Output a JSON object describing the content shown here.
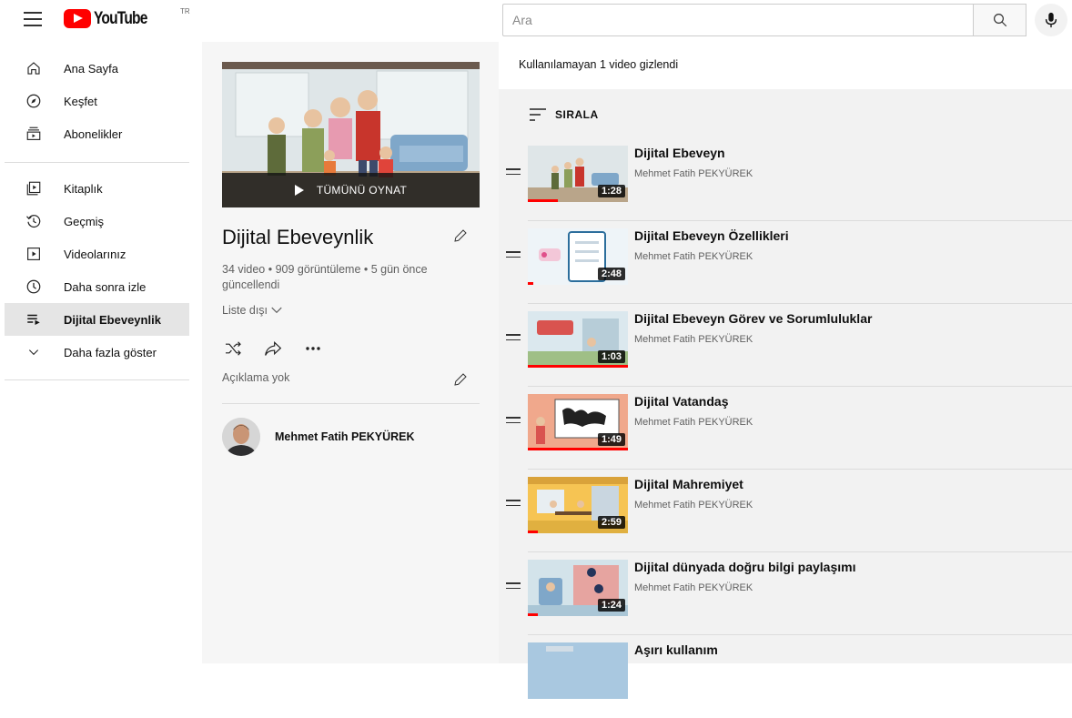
{
  "header": {
    "logo_text": "YouTube",
    "logo_country": "TR",
    "search_placeholder": "Ara",
    "icons": [
      "menu-icon",
      "search-icon",
      "mic-icon"
    ]
  },
  "sidebar": {
    "items": [
      {
        "label": "Ana Sayfa",
        "icon": "home-icon"
      },
      {
        "label": "Keşfet",
        "icon": "compass-icon"
      },
      {
        "label": "Abonelikler",
        "icon": "subscriptions-icon"
      },
      {
        "label": "Kitaplık",
        "icon": "library-icon"
      },
      {
        "label": "Geçmiş",
        "icon": "history-icon"
      },
      {
        "label": "Videolarınız",
        "icon": "your-videos-icon"
      },
      {
        "label": "Daha sonra izle",
        "icon": "watch-later-icon"
      },
      {
        "label": "Dijital Ebeveynlik",
        "icon": "playlist-icon",
        "active": true
      },
      {
        "label": "Daha fazla göster",
        "icon": "chevron-down-icon"
      }
    ]
  },
  "playlist": {
    "play_all": "TÜMÜNÜ OYNAT",
    "title": "Dijital Ebeveynlik",
    "stats": "34 video • 909 görüntüleme • 5 gün önce güncellendi",
    "privacy": "Liste dışı",
    "description": "Açıklama yok",
    "owner": "Mehmet Fatih PEKYÜREK"
  },
  "list": {
    "hidden_note": "Kullanılamayan 1 video gizlendi",
    "sort_label": "SIRALA",
    "videos": [
      {
        "title": "Dijital Ebeveyn",
        "channel": "Mehmet Fatih PEKYÜREK",
        "duration": "1:28",
        "progress": 0.3
      },
      {
        "title": "Dijital Ebeveyn Özellikleri",
        "channel": "Mehmet Fatih PEKYÜREK",
        "duration": "2:48",
        "progress": 0.05
      },
      {
        "title": "Dijital Ebeveyn Görev ve Sorumluluklar",
        "channel": "Mehmet Fatih PEKYÜREK",
        "duration": "1:03",
        "progress": 1.0
      },
      {
        "title": "Dijital Vatandaş",
        "channel": "Mehmet Fatih PEKYÜREK",
        "duration": "1:49",
        "progress": 1.0
      },
      {
        "title": "Dijital Mahremiyet",
        "channel": "Mehmet Fatih PEKYÜREK",
        "duration": "2:59",
        "progress": 0.1
      },
      {
        "title": "Dijital dünyada doğru bilgi paylaşımı",
        "channel": "Mehmet Fatih PEKYÜREK",
        "duration": "1:24",
        "progress": 0.1
      },
      {
        "title": "Aşırı kullanım",
        "channel": "",
        "duration": "",
        "progress": 0
      }
    ]
  },
  "colors": {
    "brand": "#ff0000",
    "active_bg": "#e5e5e5",
    "panel_bg": "#f6f6f6",
    "list_bg": "#f2f2f2"
  }
}
